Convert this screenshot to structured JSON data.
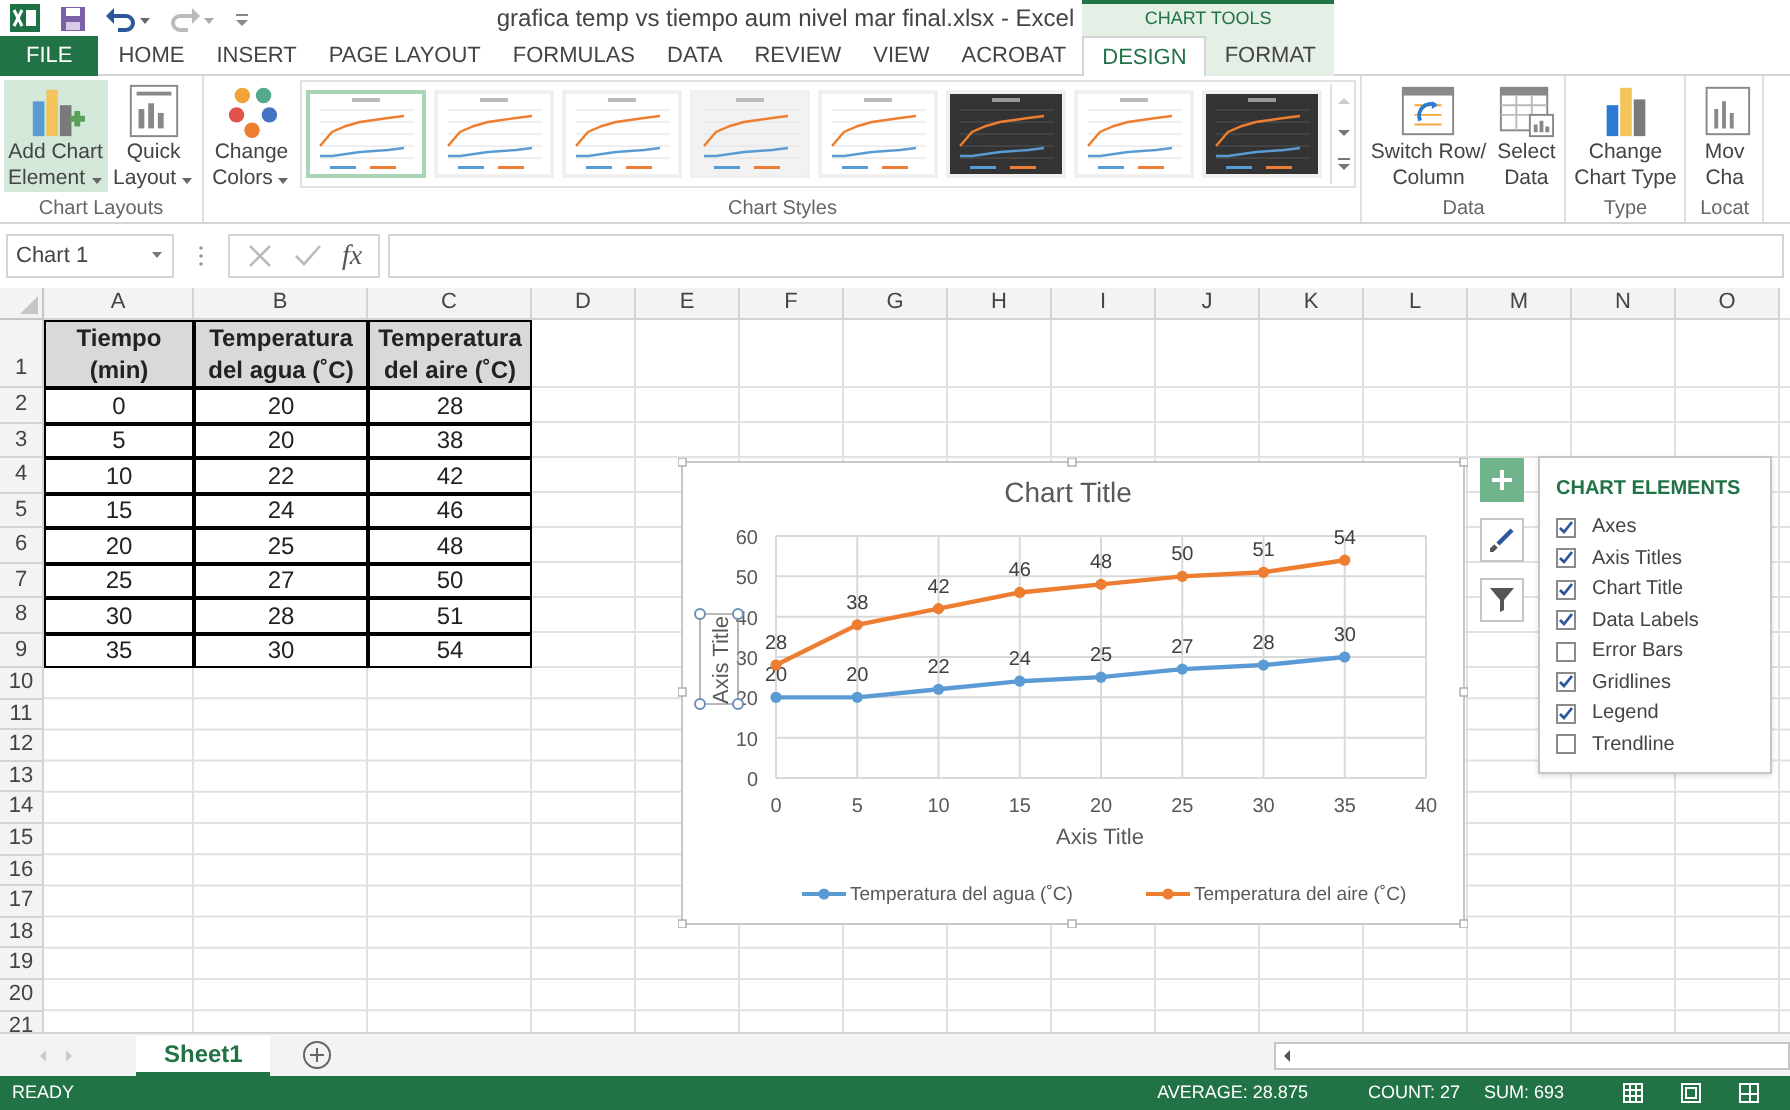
{
  "title_bar": {
    "title": "grafica temp vs tiempo aum nivel mar final.xlsx - Excel",
    "context_header": "CHART TOOLS"
  },
  "tabs": [
    {
      "label": "FILE",
      "kind": "file",
      "selected": false
    },
    {
      "label": "HOME",
      "kind": "main",
      "selected": false
    },
    {
      "label": "INSERT",
      "kind": "main",
      "selected": false
    },
    {
      "label": "PAGE LAYOUT",
      "kind": "main",
      "selected": false
    },
    {
      "label": "FORMULAS",
      "kind": "main",
      "selected": false
    },
    {
      "label": "DATA",
      "kind": "main",
      "selected": false
    },
    {
      "label": "REVIEW",
      "kind": "main",
      "selected": false
    },
    {
      "label": "VIEW",
      "kind": "main",
      "selected": false
    },
    {
      "label": "ACROBAT",
      "kind": "main",
      "selected": false
    },
    {
      "label": "DESIGN",
      "kind": "context",
      "selected": true
    },
    {
      "label": "FORMAT",
      "kind": "context",
      "selected": false
    }
  ],
  "ribbon": {
    "groups": [
      {
        "label": "Chart Layouts",
        "buttons": [
          {
            "kind": "add_element",
            "lines": [
              "Add Chart",
              "Element"
            ],
            "dropdown": true,
            "selected": true
          },
          {
            "kind": "quick_layout",
            "lines": [
              "Quick",
              "Layout"
            ],
            "dropdown": true,
            "selected": false
          }
        ]
      },
      {
        "label": "Chart Styles",
        "buttons": [
          {
            "kind": "colors",
            "lines": [
              "Change",
              "Colors"
            ],
            "dropdown": true,
            "selected": false
          }
        ],
        "styles": [
          {
            "kind": "light",
            "selected": true
          },
          {
            "kind": "light",
            "selected": false
          },
          {
            "kind": "light",
            "selected": false
          },
          {
            "kind": "shaded",
            "selected": false
          },
          {
            "kind": "light",
            "selected": false
          },
          {
            "kind": "dark",
            "selected": false
          },
          {
            "kind": "light",
            "selected": false
          },
          {
            "kind": "dark",
            "selected": false
          }
        ]
      },
      {
        "label": "Data",
        "buttons": [
          {
            "kind": "switch",
            "lines": [
              "Switch Row/",
              "Column"
            ],
            "dropdown": false,
            "selected": false
          },
          {
            "kind": "select_data",
            "lines": [
              "Select",
              "Data"
            ],
            "dropdown": false,
            "selected": false
          }
        ]
      },
      {
        "label": "Type",
        "buttons": [
          {
            "kind": "chart_type",
            "lines": [
              "Change",
              "Chart Type"
            ],
            "dropdown": false,
            "selected": false
          }
        ]
      },
      {
        "label": "Locat",
        "buttons": [
          {
            "kind": "move",
            "lines": [
              "Mov",
              "Cha"
            ],
            "dropdown": false,
            "selected": false
          }
        ]
      }
    ]
  },
  "formula_bar": {
    "name_box": "Chart 1",
    "fx": "fx"
  },
  "sheet": {
    "columns": [
      "A",
      "B",
      "C",
      "D",
      "E",
      "F",
      "G",
      "H",
      "I",
      "J",
      "K",
      "L",
      "M",
      "N",
      "O"
    ],
    "rows": [
      "1",
      "2",
      "3",
      "4",
      "5",
      "6",
      "7",
      "8",
      "9",
      "10",
      "11",
      "12",
      "13",
      "14",
      "15",
      "16",
      "17",
      "18",
      "19",
      "20",
      "21"
    ],
    "table": {
      "header": [
        "Tiempo (min)",
        "Temperatura del agua (˚C)",
        "Temperatura del aire (˚C)"
      ],
      "rows": [
        [
          "0",
          "20",
          "28"
        ],
        [
          "5",
          "20",
          "38"
        ],
        [
          "10",
          "22",
          "42"
        ],
        [
          "15",
          "24",
          "46"
        ],
        [
          "20",
          "25",
          "48"
        ],
        [
          "25",
          "27",
          "50"
        ],
        [
          "30",
          "28",
          "51"
        ],
        [
          "35",
          "30",
          "54"
        ]
      ]
    }
  },
  "chart": {
    "chart_data": {
      "type": "line",
      "title": "Chart Title",
      "xlabel": "Axis Title",
      "ylabel": "Axis Title",
      "x": [
        0,
        5,
        10,
        15,
        20,
        25,
        30,
        35
      ],
      "xlim": [
        0,
        40
      ],
      "ylim": [
        0,
        60
      ],
      "xticks": [
        0,
        5,
        10,
        15,
        20,
        25,
        30,
        35,
        40
      ],
      "yticks": [
        0,
        10,
        20,
        30,
        40,
        50,
        60
      ],
      "data_labels": true,
      "grid": true,
      "legend": true,
      "series": [
        {
          "name": "Temperatura del agua (˚C)",
          "color": "#5b9bd5",
          "marker": "circle",
          "values": [
            20,
            20,
            22,
            24,
            25,
            27,
            28,
            30
          ]
        },
        {
          "name": "Temperatura del aire (˚C)",
          "color": "#ed7d31",
          "marker": "circle",
          "values": [
            28,
            38,
            42,
            46,
            48,
            50,
            51,
            54
          ]
        }
      ]
    }
  },
  "chart_buttons": [
    {
      "kind": "elements",
      "selected": true
    },
    {
      "kind": "styles",
      "selected": false
    },
    {
      "kind": "filters",
      "selected": false
    }
  ],
  "chart_elements": {
    "title": "CHART ELEMENTS",
    "items": [
      {
        "label": "Axes",
        "checked": true
      },
      {
        "label": "Axis Titles",
        "checked": true
      },
      {
        "label": "Chart Title",
        "checked": true
      },
      {
        "label": "Data Labels",
        "checked": true
      },
      {
        "label": "Error Bars",
        "checked": false
      },
      {
        "label": "Gridlines",
        "checked": true
      },
      {
        "label": "Legend",
        "checked": true
      },
      {
        "label": "Trendline",
        "checked": false
      }
    ]
  },
  "sheet_tabs": [
    {
      "label": "Sheet1",
      "selected": true
    }
  ],
  "status_bar": {
    "mode": "READY",
    "average": "AVERAGE: 28.875",
    "count": "COUNT: 27",
    "sum": "SUM: 693",
    "views": [
      {
        "kind": "normal"
      },
      {
        "kind": "page_layout"
      },
      {
        "kind": "page_break"
      }
    ]
  }
}
